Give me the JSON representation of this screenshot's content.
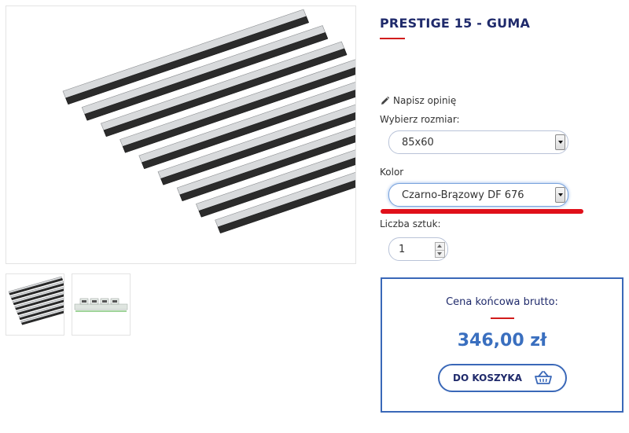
{
  "product": {
    "title": "PRESTIGE 15 - GUMA"
  },
  "review": {
    "label": "Napisz opinię",
    "icon": "pencil-icon"
  },
  "options": {
    "size_label": "Wybierz rozmiar:",
    "size_value": "85x60",
    "color_label": "Kolor",
    "color_value": "Czarno-Brązowy DF 676",
    "qty_label": "Liczba sztuk:",
    "qty_value": "1"
  },
  "price": {
    "label": "Cena końcowa brutto:",
    "value": "346,00 zł"
  },
  "cart": {
    "label": "DO KOSZYKA",
    "icon": "basket-icon"
  },
  "colors": {
    "brand_navy": "#1f2a6b",
    "accent_blue": "#3a68b8",
    "accent_red": "#d11c1c",
    "highlight_red": "#e0101a"
  }
}
